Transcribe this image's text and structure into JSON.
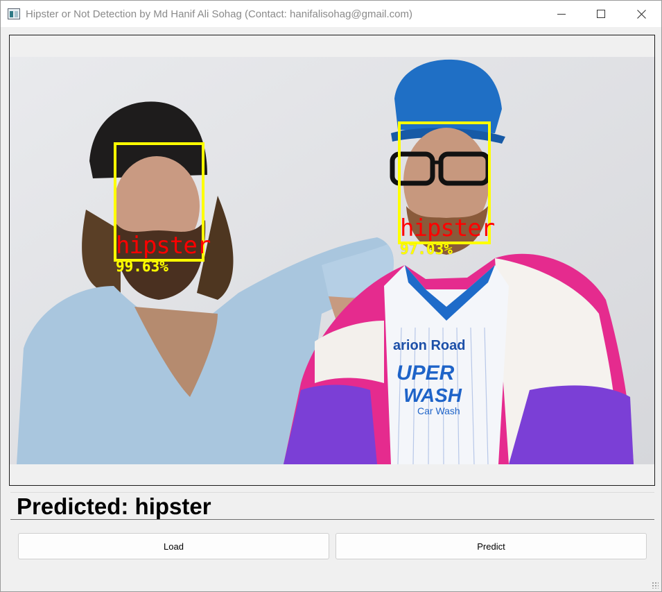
{
  "window": {
    "title": "Hipster or Not Detection by Md Hanif Ali Sohag (Contact: hanifalisohag@gmail.com)",
    "icon": "app-window-icon",
    "controls": [
      "minimize-icon",
      "maximize-icon",
      "close-icon"
    ]
  },
  "detections": [
    {
      "label": "hipster",
      "confidence": "99.63%"
    },
    {
      "label": "hipster",
      "confidence": "97.03%"
    }
  ],
  "colors": {
    "box": "#ffff00",
    "label": "#ff0000",
    "confidence": "#ffff00"
  },
  "result": {
    "text": "Predicted: hipster"
  },
  "buttons": {
    "load": "Load",
    "predict": "Predict"
  }
}
